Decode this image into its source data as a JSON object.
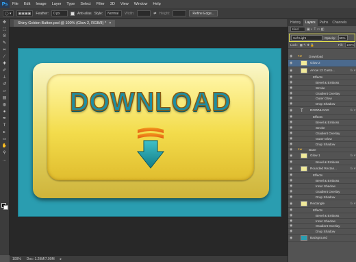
{
  "app": {
    "logo": "Ps"
  },
  "menu": [
    "File",
    "Edit",
    "Image",
    "Layer",
    "Type",
    "Select",
    "Filter",
    "3D",
    "View",
    "Window",
    "Help"
  ],
  "options": {
    "feather_label": "Feather:",
    "feather_value": "0 px",
    "antialias_label": "Anti-alias",
    "style_label": "Style:",
    "style_value": "Normal",
    "width_label": "Width:",
    "height_label": "Height:",
    "refine_label": "Refine Edge..."
  },
  "document": {
    "tab_title": "Shiny Golden Button.psd @ 100% (Glow 2, RGB/8) *",
    "button_text": "DOWNLOAD"
  },
  "status": {
    "zoom": "100%",
    "doc": "Doc: 1.29M/7.00M"
  },
  "panel": {
    "tabs": [
      "History",
      "Layers",
      "Paths",
      "Channels"
    ],
    "kind_label": "Kind",
    "blend_mode": "Soft Light",
    "opacity_label": "Opacity:",
    "opacity_value": "65%",
    "lock_label": "Lock:",
    "fill_label": "Fill:",
    "fill_value": "100%"
  },
  "layers": [
    {
      "name": "Download",
      "kind": "group",
      "indent": 0
    },
    {
      "name": "Glow 2",
      "kind": "layer",
      "indent": 1,
      "selected": true,
      "fx": false
    },
    {
      "name": "Arrow 12 Custo...",
      "kind": "layer",
      "indent": 1,
      "fx": true
    },
    {
      "name": "Effects",
      "kind": "effects",
      "indent": 2
    },
    {
      "name": "Bevel & Emboss",
      "kind": "effect",
      "indent": 3
    },
    {
      "name": "Stroke",
      "kind": "effect",
      "indent": 3
    },
    {
      "name": "Gradient Overlay",
      "kind": "effect",
      "indent": 3
    },
    {
      "name": "Outer Glow",
      "kind": "effect",
      "indent": 3
    },
    {
      "name": "Drop Shadow",
      "kind": "effect",
      "indent": 3
    },
    {
      "name": "DOWNLOAD",
      "kind": "text",
      "indent": 1,
      "fx": true
    },
    {
      "name": "Effects",
      "kind": "effects",
      "indent": 2
    },
    {
      "name": "Bevel & Emboss",
      "kind": "effect",
      "indent": 3
    },
    {
      "name": "Stroke",
      "kind": "effect",
      "indent": 3
    },
    {
      "name": "Gradient Overlay",
      "kind": "effect",
      "indent": 3
    },
    {
      "name": "Outer Glow",
      "kind": "effect",
      "indent": 3
    },
    {
      "name": "Drop Shadow",
      "kind": "effect",
      "indent": 3
    },
    {
      "name": "Base",
      "kind": "group",
      "indent": 0
    },
    {
      "name": "Glow 1",
      "kind": "layer",
      "indent": 1,
      "fx": true
    },
    {
      "name": "Bevel & Emboss",
      "kind": "effect",
      "indent": 3
    },
    {
      "name": "Rounded Rectan...",
      "kind": "layer",
      "indent": 1,
      "fx": true
    },
    {
      "name": "Effects",
      "kind": "effects",
      "indent": 2
    },
    {
      "name": "Bevel & Emboss",
      "kind": "effect",
      "indent": 3
    },
    {
      "name": "Inner Shadow",
      "kind": "effect",
      "indent": 3
    },
    {
      "name": "Gradient Overlay",
      "kind": "effect",
      "indent": 3
    },
    {
      "name": "Drop Shadow",
      "kind": "effect",
      "indent": 3
    },
    {
      "name": "Rectangle",
      "kind": "layer",
      "indent": 1,
      "fx": true
    },
    {
      "name": "Effects",
      "kind": "effects",
      "indent": 2
    },
    {
      "name": "Bevel & Emboss",
      "kind": "effect",
      "indent": 3
    },
    {
      "name": "Inner Shadow",
      "kind": "effect",
      "indent": 3
    },
    {
      "name": "Gradient Overlay",
      "kind": "effect",
      "indent": 3
    },
    {
      "name": "Drop Shadow",
      "kind": "effect",
      "indent": 3
    },
    {
      "name": "Background",
      "kind": "layer",
      "indent": 0,
      "fx": false
    }
  ],
  "colors": {
    "accent_highlight": "#e3e04a",
    "teal": "#2a9db0",
    "gold": "#f3dc4c"
  }
}
